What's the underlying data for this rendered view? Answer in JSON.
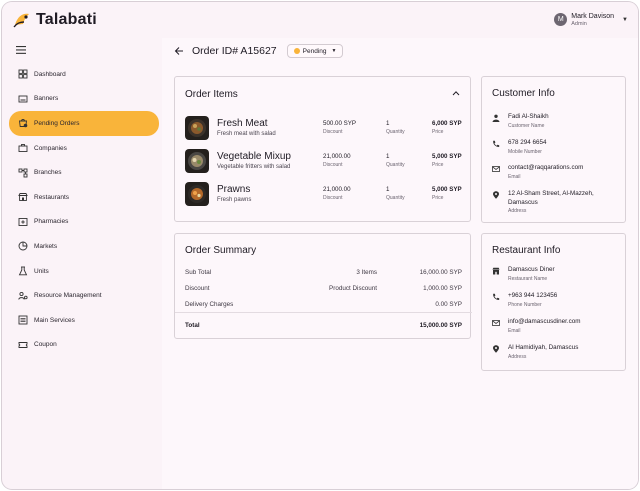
{
  "app": {
    "brand": "Talabati",
    "accent": "#f9b43a"
  },
  "user": {
    "initial": "M",
    "name": "Mark Davison",
    "role": "Admin"
  },
  "sidebar": {
    "items": [
      {
        "label": "Dashboard",
        "icon": "dashboard-icon"
      },
      {
        "label": "Banners",
        "icon": "banner-icon"
      },
      {
        "label": "Pending Orders",
        "icon": "pending-orders-icon",
        "active": true
      },
      {
        "label": "Companies",
        "icon": "briefcase-icon"
      },
      {
        "label": "Branches",
        "icon": "branches-icon"
      },
      {
        "label": "Restaurants",
        "icon": "storefront-icon"
      },
      {
        "label": "Pharmacies",
        "icon": "pharmacy-icon"
      },
      {
        "label": "Markets",
        "icon": "pie-chart-icon"
      },
      {
        "label": "Units",
        "icon": "flask-icon"
      },
      {
        "label": "Resource Management",
        "icon": "people-gear-icon"
      },
      {
        "label": "Main Services",
        "icon": "list-box-icon"
      },
      {
        "label": "Coupon",
        "icon": "coupon-icon"
      }
    ]
  },
  "order": {
    "title": "Order ID# A15627",
    "status": "Pending"
  },
  "order_items": {
    "title": "Order Items",
    "discount_label": "Discount",
    "quantity_label": "Quantity",
    "price_label": "Price",
    "items": [
      {
        "name": "Fresh Meat",
        "desc": "Fresh meat with salad",
        "discount": "500.00 SYP",
        "quantity": "1",
        "price": "6,000 SYP"
      },
      {
        "name": "Vegetable Mixup",
        "desc": "Vegetable fritters with salad",
        "discount": "21,000.00",
        "quantity": "1",
        "price": "5,000 SYP"
      },
      {
        "name": "Prawns",
        "desc": "Fresh pawns",
        "discount": "21,000.00",
        "quantity": "1",
        "price": "5,000 SYP"
      }
    ]
  },
  "summary": {
    "title": "Order Summary",
    "rows": [
      {
        "label": "Sub Total",
        "middle": "3 Items",
        "value": "16,000.00 SYP"
      },
      {
        "label": "Discount",
        "middle": "Product Discount",
        "value": "1,000.00 SYP"
      },
      {
        "label": "Delivery Charges",
        "middle": "",
        "value": "0.00 SYP"
      }
    ],
    "total": {
      "label": "Total",
      "value": "15,000.00 SYP"
    }
  },
  "customer": {
    "title": "Customer Info",
    "name": "Fadi Al-Shaikh",
    "name_label": "Customer Name",
    "phone": "678 294 6654",
    "phone_label": "Mobile Number",
    "email": "contact@raqqarations.com",
    "email_label": "Email",
    "address": "12 Al-Sham Street, Al-Mazzeh, Damascus",
    "address_label": "Address"
  },
  "restaurant": {
    "title": "Restaurant Info",
    "name": "Damascus Diner",
    "name_label": "Restaurant Name",
    "phone": "+963 944 123456",
    "phone_label": "Phone Number",
    "email": "info@damascusdiner.com",
    "email_label": "Email",
    "address": "Al Hamidiyah, Damascus",
    "address_label": "Address"
  }
}
